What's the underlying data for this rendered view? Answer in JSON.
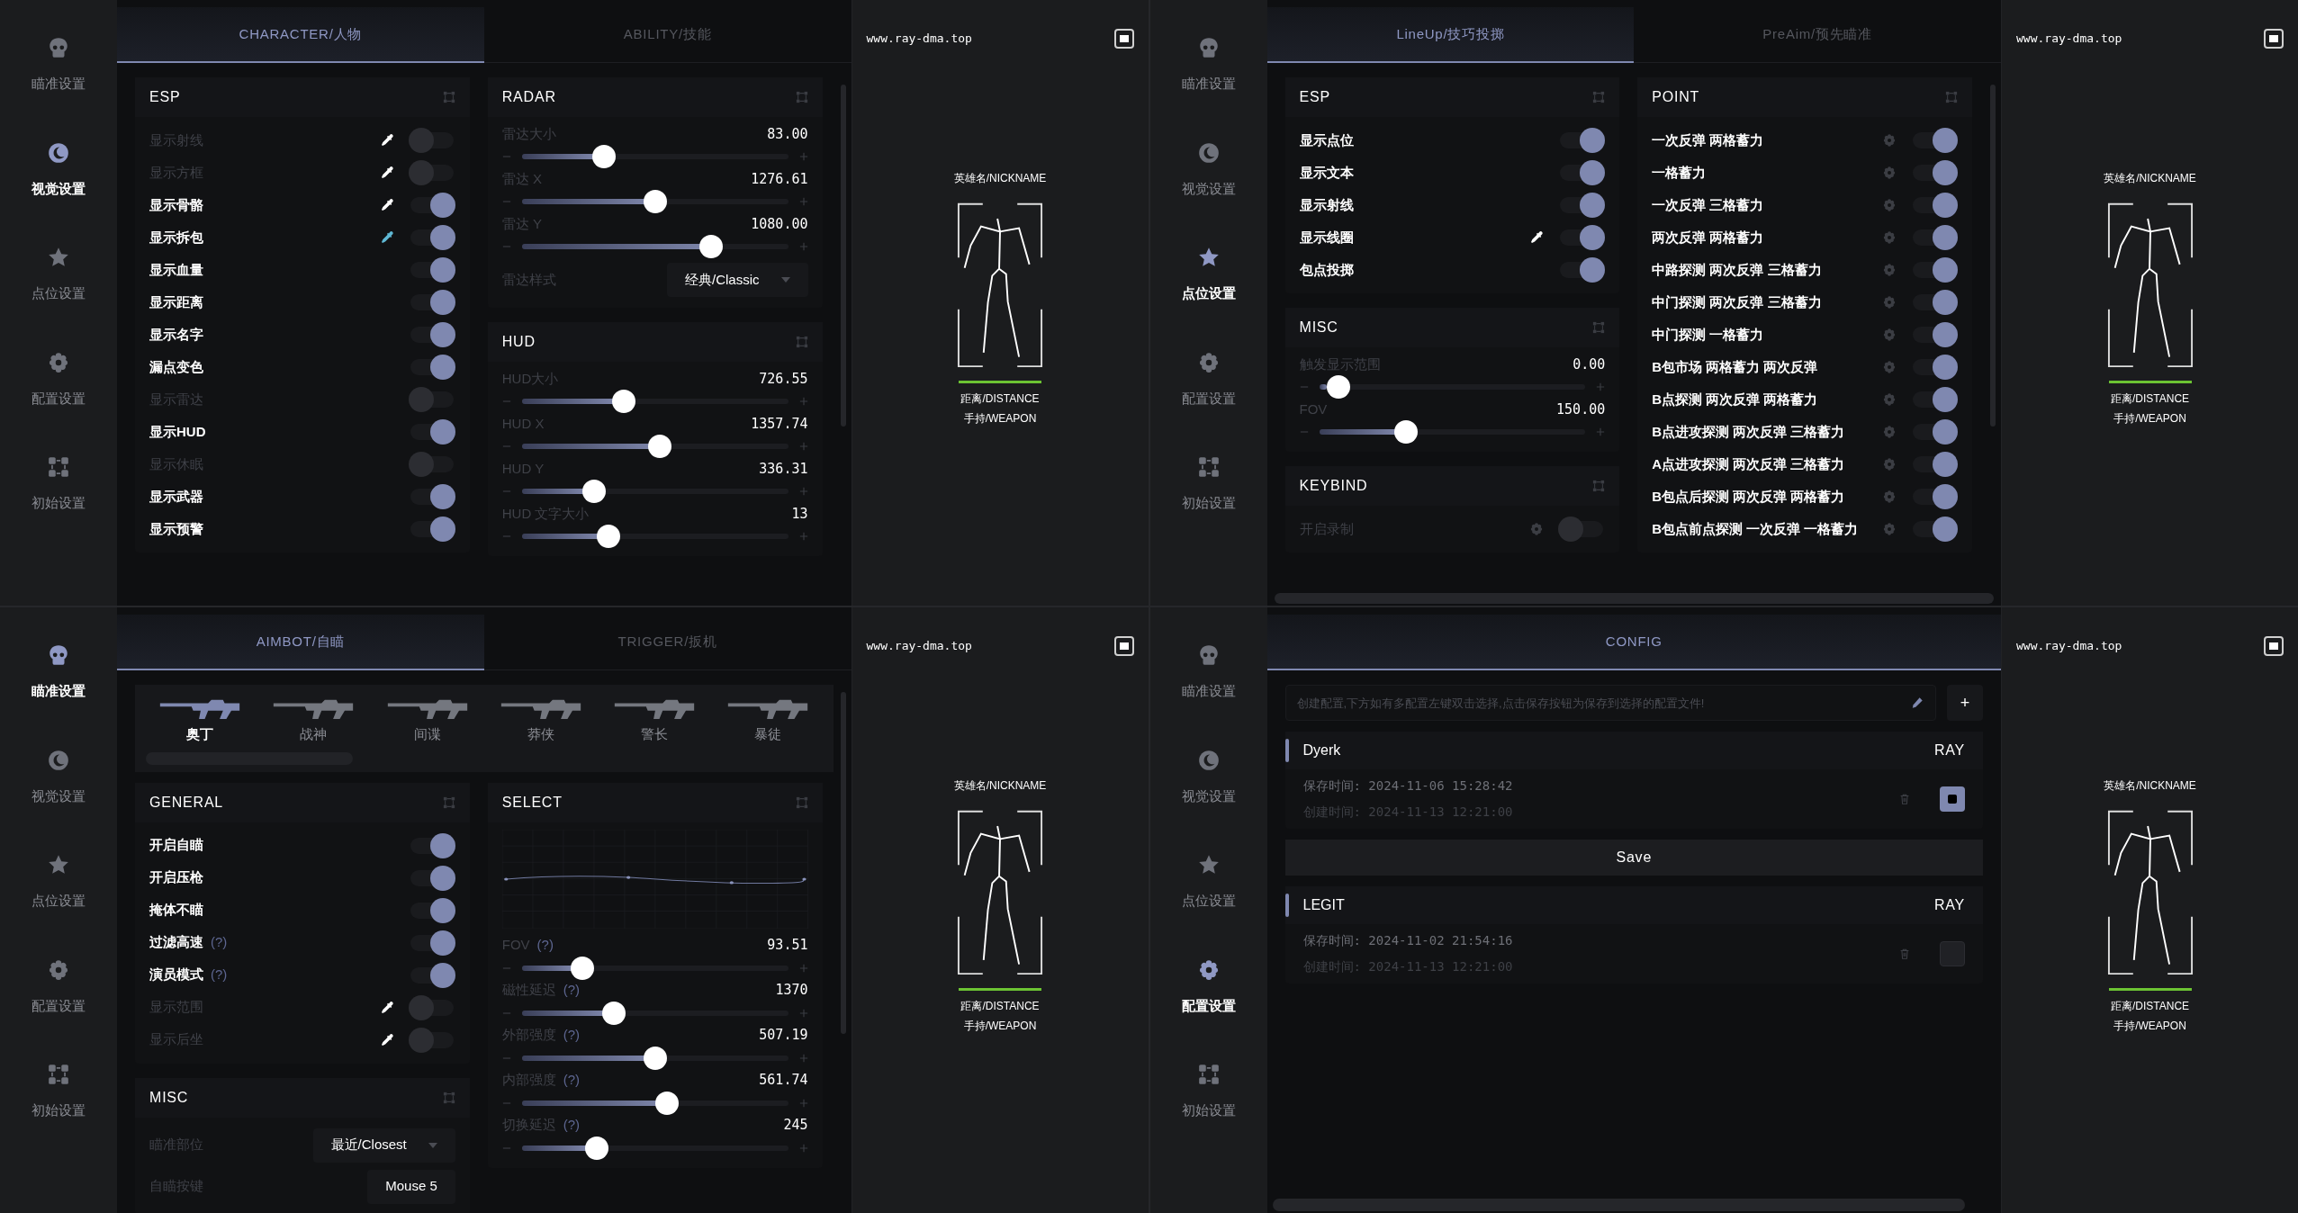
{
  "windows": [
    {
      "sidebar": [
        {
          "label": "瞄准设置",
          "selected": false
        },
        {
          "label": "视觉设置",
          "selected": true
        },
        {
          "label": "点位设置",
          "selected": false
        },
        {
          "label": "配置设置",
          "selected": false
        },
        {
          "label": "初始设置",
          "selected": false
        }
      ],
      "tabs": [
        {
          "label": "CHARACTER/人物",
          "selected": true
        },
        {
          "label": "ABILITY/技能",
          "selected": false
        }
      ],
      "panel": {
        "kind": "columns",
        "columns": [
          [
            {
              "title": "ESP",
              "items": [
                {
                  "kind": "toggle",
                  "label": "显示射线",
                  "on": false,
                  "color": "#ffffff"
                },
                {
                  "kind": "toggle",
                  "label": "显示方框",
                  "on": false,
                  "color": "#ffffff"
                },
                {
                  "kind": "toggle",
                  "label": "显示骨骼",
                  "on": true,
                  "color": "#ffffff"
                },
                {
                  "kind": "toggle",
                  "label": "显示拆包",
                  "on": true,
                  "color": "#5fb8d4"
                },
                {
                  "kind": "toggle",
                  "label": "显示血量",
                  "on": true
                },
                {
                  "kind": "toggle",
                  "label": "显示距离",
                  "on": true
                },
                {
                  "kind": "toggle",
                  "label": "显示名字",
                  "on": true
                },
                {
                  "kind": "toggle",
                  "label": "漏点变色",
                  "on": true
                },
                {
                  "kind": "toggle",
                  "label": "显示雷达",
                  "on": false
                },
                {
                  "kind": "toggle",
                  "label": "显示HUD",
                  "on": true
                },
                {
                  "kind": "toggle",
                  "label": "显示休眠",
                  "on": false
                },
                {
                  "kind": "toggle",
                  "label": "显示武器",
                  "on": true
                },
                {
                  "kind": "toggle",
                  "label": "显示预警",
                  "on": true
                }
              ]
            }
          ],
          [
            {
              "title": "RADAR",
              "items": [
                {
                  "kind": "slider",
                  "label": "雷达大小",
                  "value": "83.00",
                  "level": 0.29
                },
                {
                  "kind": "slider",
                  "label": "雷达 X",
                  "value": "1276.61",
                  "level": 0.5
                },
                {
                  "kind": "slider",
                  "label": "雷达 Y",
                  "value": "1080.00",
                  "level": 0.73
                },
                {
                  "kind": "select",
                  "label": "雷达样式",
                  "value": "经典/Classic"
                }
              ]
            },
            {
              "title": "HUD",
              "items": [
                {
                  "kind": "slider",
                  "label": "HUD大小",
                  "value": "726.55",
                  "level": 0.37
                },
                {
                  "kind": "slider",
                  "label": "HUD X",
                  "value": "1357.74",
                  "level": 0.52
                },
                {
                  "kind": "slider",
                  "label": "HUD Y",
                  "value": "336.31",
                  "level": 0.25
                },
                {
                  "kind": "slider",
                  "label": "HUD 文字大小",
                  "value": "13",
                  "level": 0.31
                }
              ]
            }
          ]
        ]
      },
      "preview": {
        "url": "www.ray-dma.top",
        "nickname": "英雄名/NICKNAME",
        "distance": "距离/DISTANCE",
        "weapon": "手持/WEAPON"
      }
    },
    {
      "sidebar": [
        {
          "label": "瞄准设置",
          "selected": false
        },
        {
          "label": "视觉设置",
          "selected": false
        },
        {
          "label": "点位设置",
          "selected": true
        },
        {
          "label": "配置设置",
          "selected": false
        },
        {
          "label": "初始设置",
          "selected": false
        }
      ],
      "tabs": [
        {
          "label": "LineUp/技巧投掷",
          "selected": true
        },
        {
          "label": "PreAim/预先瞄准",
          "selected": false
        }
      ],
      "panel": {
        "kind": "columns",
        "columns": [
          [
            {
              "title": "ESP",
              "items": [
                {
                  "kind": "toggle",
                  "label": "显示点位",
                  "on": true
                },
                {
                  "kind": "toggle",
                  "label": "显示文本",
                  "on": true
                },
                {
                  "kind": "toggle",
                  "label": "显示射线",
                  "on": true
                },
                {
                  "kind": "toggle",
                  "label": "显示线圈",
                  "on": true,
                  "color": "#ffffff"
                },
                {
                  "kind": "toggle",
                  "label": "包点投掷",
                  "on": true
                }
              ]
            },
            {
              "title": "MISC",
              "items": [
                {
                  "kind": "slider",
                  "label": "触发显示范围",
                  "value": "0.00",
                  "level": 0.03
                },
                {
                  "kind": "slider",
                  "label": "FOV",
                  "value": "150.00",
                  "level": 0.31
                }
              ]
            },
            {
              "title": "KEYBIND",
              "items": [
                {
                  "kind": "toggle-gear",
                  "label": "开启录制",
                  "on": false
                }
              ]
            }
          ],
          [
            {
              "title": "POINT",
              "items": [
                {
                  "kind": "toggle-gear",
                  "label": "一次反弹 两格蓄力",
                  "on": true
                },
                {
                  "kind": "toggle-gear",
                  "label": "一格蓄力",
                  "on": true
                },
                {
                  "kind": "toggle-gear",
                  "label": "一次反弹 三格蓄力",
                  "on": true
                },
                {
                  "kind": "toggle-gear",
                  "label": "两次反弹 两格蓄力",
                  "on": true
                },
                {
                  "kind": "toggle-gear",
                  "label": "中路探测 两次反弹 三格蓄力",
                  "on": true
                },
                {
                  "kind": "toggle-gear",
                  "label": "中门探测 两次反弹 三格蓄力",
                  "on": true
                },
                {
                  "kind": "toggle-gear",
                  "label": "中门探测 一格蓄力",
                  "on": true
                },
                {
                  "kind": "toggle-gear",
                  "label": "B包市场 两格蓄力 两次反弹",
                  "on": true
                },
                {
                  "kind": "toggle-gear",
                  "label": "B点探测 两次反弹 两格蓄力",
                  "on": true
                },
                {
                  "kind": "toggle-gear",
                  "label": "B点进攻探测 两次反弹 三格蓄力",
                  "on": true
                },
                {
                  "kind": "toggle-gear",
                  "label": "A点进攻探测 两次反弹 三格蓄力",
                  "on": true
                },
                {
                  "kind": "toggle-gear",
                  "label": "B包点后探测 两次反弹 两格蓄力",
                  "on": true
                },
                {
                  "kind": "toggle-gear",
                  "label": "B包点前点探测 一次反弹 一格蓄力",
                  "on": true
                }
              ]
            }
          ]
        ]
      },
      "preview": {
        "url": "www.ray-dma.top",
        "nickname": "英雄名/NICKNAME",
        "distance": "距离/DISTANCE",
        "weapon": "手持/WEAPON"
      }
    },
    {
      "sidebar": [
        {
          "label": "瞄准设置",
          "selected": true
        },
        {
          "label": "视觉设置",
          "selected": false
        },
        {
          "label": "点位设置",
          "selected": false
        },
        {
          "label": "配置设置",
          "selected": false
        },
        {
          "label": "初始设置",
          "selected": false
        }
      ],
      "tabs": [
        {
          "label": "AIMBOT/自瞄",
          "selected": true
        },
        {
          "label": "TRIGGER/扳机",
          "selected": false
        }
      ],
      "panel": {
        "kind": "columns",
        "weapons": [
          {
            "label": "奥丁",
            "selected": true
          },
          {
            "label": "战神",
            "selected": false
          },
          {
            "label": "间谍",
            "selected": false
          },
          {
            "label": "莽侠",
            "selected": false
          },
          {
            "label": "警长",
            "selected": false
          },
          {
            "label": "暴徒",
            "selected": false
          }
        ],
        "columns": [
          [
            {
              "title": "GENERAL",
              "items": [
                {
                  "kind": "toggle",
                  "label": "开启自瞄",
                  "on": true
                },
                {
                  "kind": "toggle",
                  "label": "开启压枪",
                  "on": true
                },
                {
                  "kind": "toggle",
                  "label": "掩体不瞄",
                  "on": true
                },
                {
                  "kind": "toggle",
                  "label": "过滤高速",
                  "help": "(?)",
                  "on": true
                },
                {
                  "kind": "toggle",
                  "label": "演员模式",
                  "help": "(?)",
                  "on": true
                },
                {
                  "kind": "toggle",
                  "label": "显示范围",
                  "on": false,
                  "color": "#ffffff"
                },
                {
                  "kind": "toggle",
                  "label": "显示后坐",
                  "on": false,
                  "color": "#ffffff"
                }
              ]
            },
            {
              "title": "MISC",
              "items": [
                {
                  "kind": "select",
                  "label": "瞄准部位",
                  "value": "最近/Closest"
                },
                {
                  "kind": "key",
                  "label": "自瞄按键",
                  "value": "Mouse 5"
                }
              ]
            }
          ],
          [
            {
              "title": "SELECT",
              "curve": true,
              "items": [
                {
                  "kind": "slider",
                  "label": "FOV",
                  "help": "(?)",
                  "value": "93.51",
                  "level": 0.2
                },
                {
                  "kind": "slider",
                  "label": "磁性延迟",
                  "help": "(?)",
                  "value": "1370",
                  "level": 0.33
                },
                {
                  "kind": "slider",
                  "label": "外部强度",
                  "help": "(?)",
                  "value": "507.19",
                  "level": 0.5
                },
                {
                  "kind": "slider",
                  "label": "内部强度",
                  "help": "(?)",
                  "value": "561.74",
                  "level": 0.55
                },
                {
                  "kind": "slider",
                  "label": "切换延迟",
                  "help": "(?)",
                  "value": "245",
                  "level": 0.26
                }
              ]
            }
          ]
        ]
      },
      "preview": {
        "url": "www.ray-dma.top",
        "nickname": "英雄名/NICKNAME",
        "distance": "距离/DISTANCE",
        "weapon": "手持/WEAPON"
      }
    },
    {
      "sidebar": [
        {
          "label": "瞄准设置",
          "selected": false
        },
        {
          "label": "视觉设置",
          "selected": false
        },
        {
          "label": "点位设置",
          "selected": false
        },
        {
          "label": "配置设置",
          "selected": true
        },
        {
          "label": "初始设置",
          "selected": false
        }
      ],
      "tabs": [
        {
          "label": "CONFIG",
          "selected": true
        }
      ],
      "panel": {
        "kind": "config",
        "placeholder": "创建配置,下方如有多配置左键双击选择,点击保存按钮为保存到选择的配置文件!",
        "add_label": "+",
        "save_label": "Save",
        "configs": [
          {
            "name": "Dyerk",
            "tag": "RAY",
            "saved": "保存时间: 2024-11-06 15:28:42",
            "created": "创建时间: 2024-11-13 12:21:00",
            "selected": true
          },
          {
            "name": "LEGIT",
            "tag": "RAY",
            "saved": "保存时间: 2024-11-02 21:54:16",
            "created": "创建时间: 2024-11-13 12:21:00",
            "selected": false
          }
        ]
      },
      "preview": {
        "url": "www.ray-dma.top",
        "nickname": "英雄名/NICKNAME",
        "distance": "距离/DISTANCE",
        "weapon": "手持/WEAPON"
      }
    }
  ]
}
